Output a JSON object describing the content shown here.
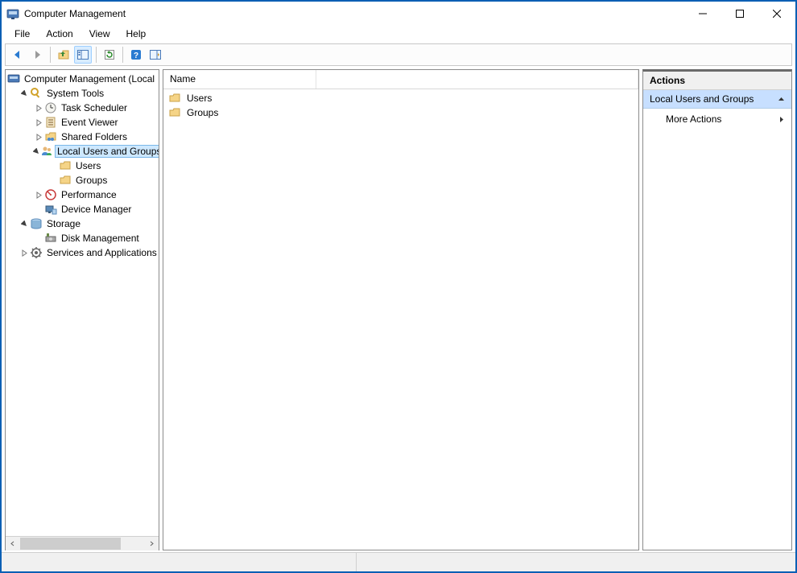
{
  "window": {
    "title": "Computer Management"
  },
  "menu": {
    "file": "File",
    "action": "Action",
    "view": "View",
    "help": "Help"
  },
  "tree": {
    "root": "Computer Management (Local",
    "system_tools": "System Tools",
    "task_scheduler": "Task Scheduler",
    "event_viewer": "Event Viewer",
    "shared_folders": "Shared Folders",
    "local_users_groups": "Local Users and Groups",
    "users": "Users",
    "groups": "Groups",
    "performance": "Performance",
    "device_manager": "Device Manager",
    "storage": "Storage",
    "disk_management": "Disk Management",
    "services_apps": "Services and Applications"
  },
  "list": {
    "col_name": "Name",
    "items": {
      "users": "Users",
      "groups": "Groups"
    }
  },
  "actions": {
    "header": "Actions",
    "selected": "Local Users and Groups",
    "more": "More Actions"
  }
}
